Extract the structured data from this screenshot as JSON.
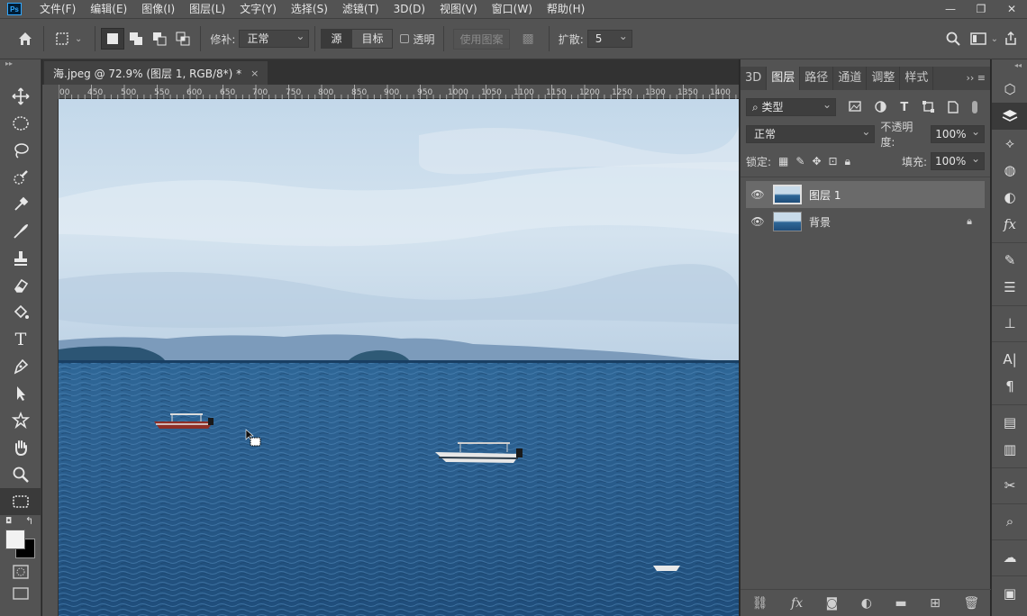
{
  "menubar": {
    "logo": "Ps",
    "items": [
      "文件(F)",
      "编辑(E)",
      "图像(I)",
      "图层(L)",
      "文字(Y)",
      "选择(S)",
      "滤镜(T)",
      "3D(D)",
      "视图(V)",
      "窗口(W)",
      "帮助(H)"
    ],
    "window_controls": [
      "—",
      "❐",
      "✕"
    ]
  },
  "options": {
    "repair_label": "修补:",
    "repair_mode": "正常",
    "source": "源",
    "target": "目标",
    "transparent": "透明",
    "use_pattern": "使用图案",
    "spread_label": "扩散:",
    "spread_value": "5"
  },
  "document": {
    "tab_title": "海.jpeg @ 72.9% (图层 1, RGB/8*) *",
    "close": "×",
    "ruler_labels": [
      "00",
      "450",
      "500",
      "550",
      "600",
      "650",
      "700",
      "750",
      "800",
      "850",
      "900",
      "950",
      "1000",
      "1050",
      "1100",
      "1150",
      "1200",
      "1250",
      "1300",
      "1350",
      "1400"
    ]
  },
  "panel": {
    "tabs": [
      "3D",
      "图层",
      "路径",
      "通道",
      "调整",
      "样式"
    ],
    "active_tab": "图层",
    "filter_kind": "类型",
    "blend_mode": "正常",
    "opacity_label": "不透明度:",
    "opacity_value": "100%",
    "lock_label": "锁定:",
    "fill_label": "填充:",
    "fill_value": "100%",
    "layers": [
      {
        "name": "图层 1",
        "selected": true,
        "locked": false
      },
      {
        "name": "背景",
        "selected": false,
        "locked": true
      }
    ]
  },
  "colors": {
    "ui_bg": "#535353",
    "dark_bg": "#282828",
    "sea": "#2a5d8c",
    "sky": "#c9dcec"
  }
}
